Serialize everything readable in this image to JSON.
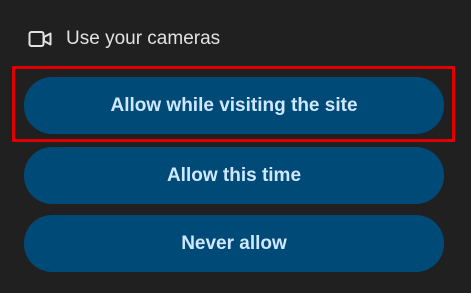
{
  "header": {
    "icon": "video-camera-icon",
    "label": "Use your cameras"
  },
  "buttons": {
    "allow_while_visiting": "Allow while visiting the site",
    "allow_this_time": "Allow this time",
    "never_allow": "Never allow"
  },
  "colors": {
    "background": "#202020",
    "button_bg": "#004a77",
    "button_text": "#cfe8ff",
    "header_text": "#e2e2e2",
    "highlight": "#e00000"
  }
}
